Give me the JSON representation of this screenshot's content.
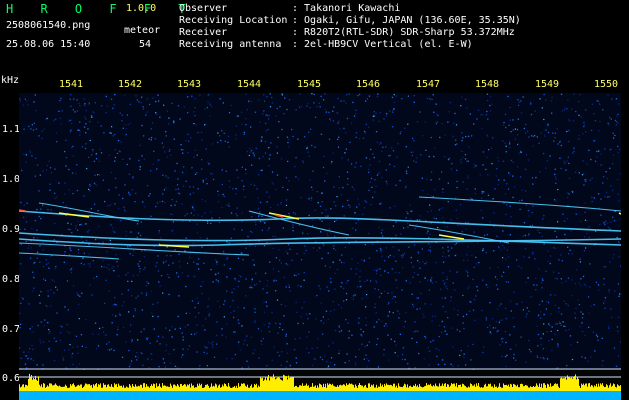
{
  "header": {
    "logo": "H R O F F T",
    "version": "1.0.0",
    "filename": "2508061540.png",
    "datetime": "25.08.06 15:40",
    "meteor_label": "meteor",
    "meteor_count": "54",
    "info": [
      {
        "label": "Observer",
        "value": ": Takanori Kawachi"
      },
      {
        "label": "Receiving Location",
        "value": ": Ogaki, Gifu, JAPAN (136.60E, 35.35N)"
      },
      {
        "label": "Receiver",
        "value": ": R820T2(RTL-SDR) SDR-Sharp 53.372MHz"
      },
      {
        "label": "Receiving antenna",
        "value": ": 2el-HB9CV Vertical (el. E-W)"
      }
    ]
  },
  "spectrogram": {
    "unit": "kHz",
    "time_ticks": [
      "1541",
      "1542",
      "1543",
      "1544",
      "1545",
      "1546",
      "1547",
      "1548",
      "1549",
      "1550"
    ],
    "freq_ticks": [
      "1.1",
      "1.0",
      "0.9",
      "0.8",
      "0.7",
      "0.6"
    ],
    "colors": {
      "background": "#02081c",
      "trace": "#4fd0ff",
      "bright": "#ffff44",
      "hot": "#ff5533",
      "bar": "#ffee00",
      "base": "#00b4ff"
    }
  }
}
